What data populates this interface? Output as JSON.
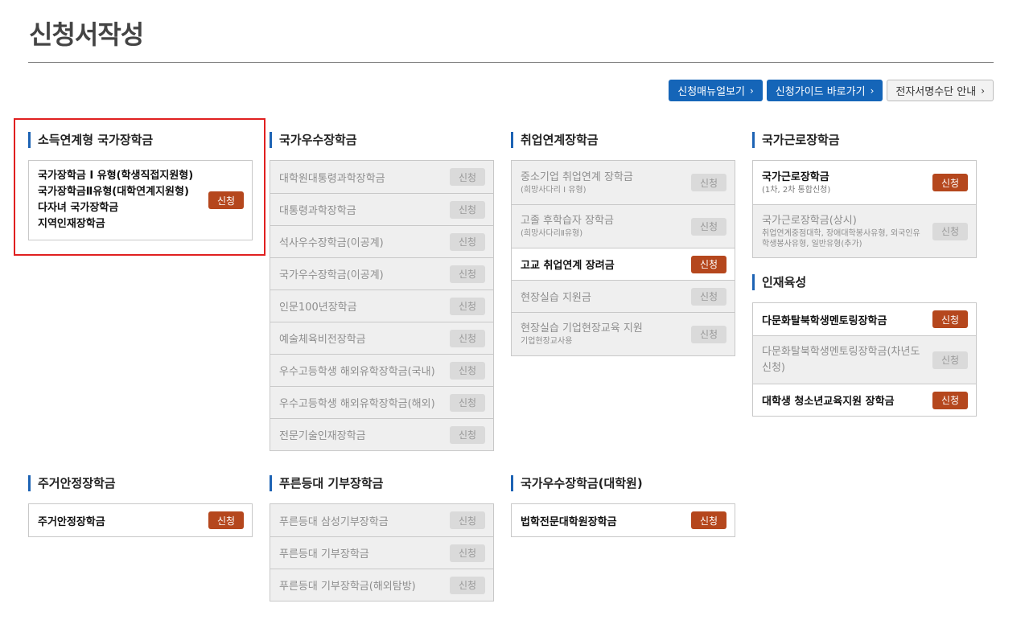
{
  "title": "신청서작성",
  "top_buttons": [
    {
      "label": "신청매뉴얼보기"
    },
    {
      "label": "신청가이드 바로가기"
    },
    {
      "label": "전자서명수단 안내"
    }
  ],
  "apply_label": "신청",
  "sec_income": {
    "title": "소득연계형 국가장학금",
    "items": [
      "국가장학금 I 유형(학생직접지원형)",
      "국가장학금Ⅱ유형(대학연계지원형)",
      "다자녀 국가장학금",
      "지역인재장학금"
    ]
  },
  "sec_excellence": {
    "title": "국가우수장학금",
    "items": [
      "대학원대통령과학장학금",
      "대통령과학장학금",
      "석사우수장학금(이공계)",
      "국가우수장학금(이공계)",
      "인문100년장학금",
      "예술체육비전장학금",
      "우수고등학생 해외유학장학금(국내)",
      "우수고등학생 해외유학장학금(해외)",
      "전문기술인재장학금"
    ]
  },
  "sec_employment": {
    "title": "취업연계장학금",
    "items": [
      {
        "label": "중소기업 취업연계 장학금",
        "sub": "(희망사다리 I 유형)"
      },
      {
        "label": "고졸 후학습자 장학금",
        "sub": "(희망사다리Ⅱ유형)"
      },
      {
        "label": "고교 취업연계 장려금",
        "sub": ""
      },
      {
        "label": "현장실습 지원금",
        "sub": ""
      },
      {
        "label": "현장실습 기업현장교육 지원",
        "sub": "기업현장교사용"
      }
    ]
  },
  "sec_work": {
    "title": "국가근로장학금",
    "items": [
      {
        "label": "국가근로장학금",
        "sub": "(1차, 2차 통합신청)"
      },
      {
        "label": "국가근로장학금(상시)",
        "sub": "취업연계중점대학, 장애대학봉사유형, 외국인유학생봉사유형, 일반유형(추가)"
      }
    ]
  },
  "sec_talent": {
    "title": "인재육성",
    "items": [
      "다문화탈북학생멘토링장학금",
      "다문화탈북학생멘토링장학금(차년도 신청)",
      "대학생 청소년교육지원 장학금"
    ]
  },
  "sec_housing": {
    "title": "주거안정장학금",
    "items": [
      "주거안정장학금"
    ]
  },
  "sec_donation": {
    "title": "푸른등대 기부장학금",
    "items": [
      "푸른등대 삼성기부장학금",
      "푸른등대 기부장학금",
      "푸른등대 기부장학금(해외탐방)"
    ]
  },
  "sec_grad": {
    "title": "국가우수장학금(대학원)",
    "items": [
      "법학전문대학원장학금"
    ]
  },
  "colors": {
    "accent": "#1565b8",
    "apply": "#b5471d",
    "highlight": "#e02020"
  }
}
